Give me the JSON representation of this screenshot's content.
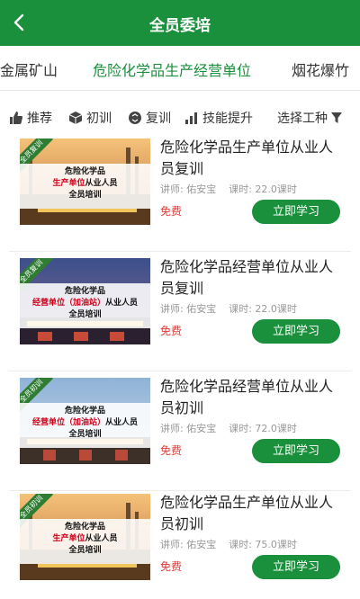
{
  "header": {
    "title": "全员委培",
    "back_icon": "chevron-left-icon"
  },
  "categories": [
    {
      "label": "非金属矿山"
    },
    {
      "label": "危险化学品生产经营单位",
      "active": true
    },
    {
      "label": "烟花爆竹"
    }
  ],
  "filters": {
    "recommend": {
      "label": "推荐",
      "icon": "thumbs-up-icon"
    },
    "initial": {
      "label": "初训",
      "icon": "cube-icon"
    },
    "retrain": {
      "label": "复训",
      "icon": "recycle-icon"
    },
    "skill": {
      "label": "技能提升",
      "icon": "bar-chart-icon"
    },
    "select_type": {
      "label": "选择工种",
      "icon": "filter-icon"
    }
  },
  "courses": [
    {
      "title": "危险化学品生产单位从业人员复训",
      "teacher": "讲师: 佑安宝",
      "hours": "课时: 22.0课时",
      "price": "免费",
      "button": "立即学习",
      "thumb": {
        "ribbon": "全员复训",
        "line1": "危险化学品",
        "line2_red": "生产单位",
        "line2_rest": "从业人员",
        "line3": "全员培训"
      }
    },
    {
      "title": "危险化学品经营单位从业人员复训",
      "teacher": "讲师: 佑安宝",
      "hours": "课时: 22.0课时",
      "price": "免费",
      "button": "立即学习",
      "thumb": {
        "ribbon": "全员复训",
        "line1": "危险化学品",
        "line2_red": "经营单位（加油站）",
        "line2_rest": "从业人员",
        "line3": "全员培训"
      }
    },
    {
      "title": "危险化学品经营单位从业人员初训",
      "teacher": "讲师: 佑安宝",
      "hours": "课时: 72.0课时",
      "price": "免费",
      "button": "立即学习",
      "thumb": {
        "ribbon": "全员初训",
        "line1": "危险化学品",
        "line2_red": "经营单位（加油站）",
        "line2_rest": "从业人员",
        "line3": "全员培训"
      }
    },
    {
      "title": "危险化学品生产单位从业人员初训",
      "teacher": "讲师: 佑安宝",
      "hours": "课时: 75.0课时",
      "price": "免费",
      "button": "立即学习",
      "thumb": {
        "ribbon": "全员初训",
        "line1": "危险化学品",
        "line2_red": "生产单位",
        "line2_rest": "从业人员",
        "line3": "全员培训"
      }
    }
  ],
  "colors": {
    "brand": "#1a8f3c",
    "price": "#e53935"
  }
}
